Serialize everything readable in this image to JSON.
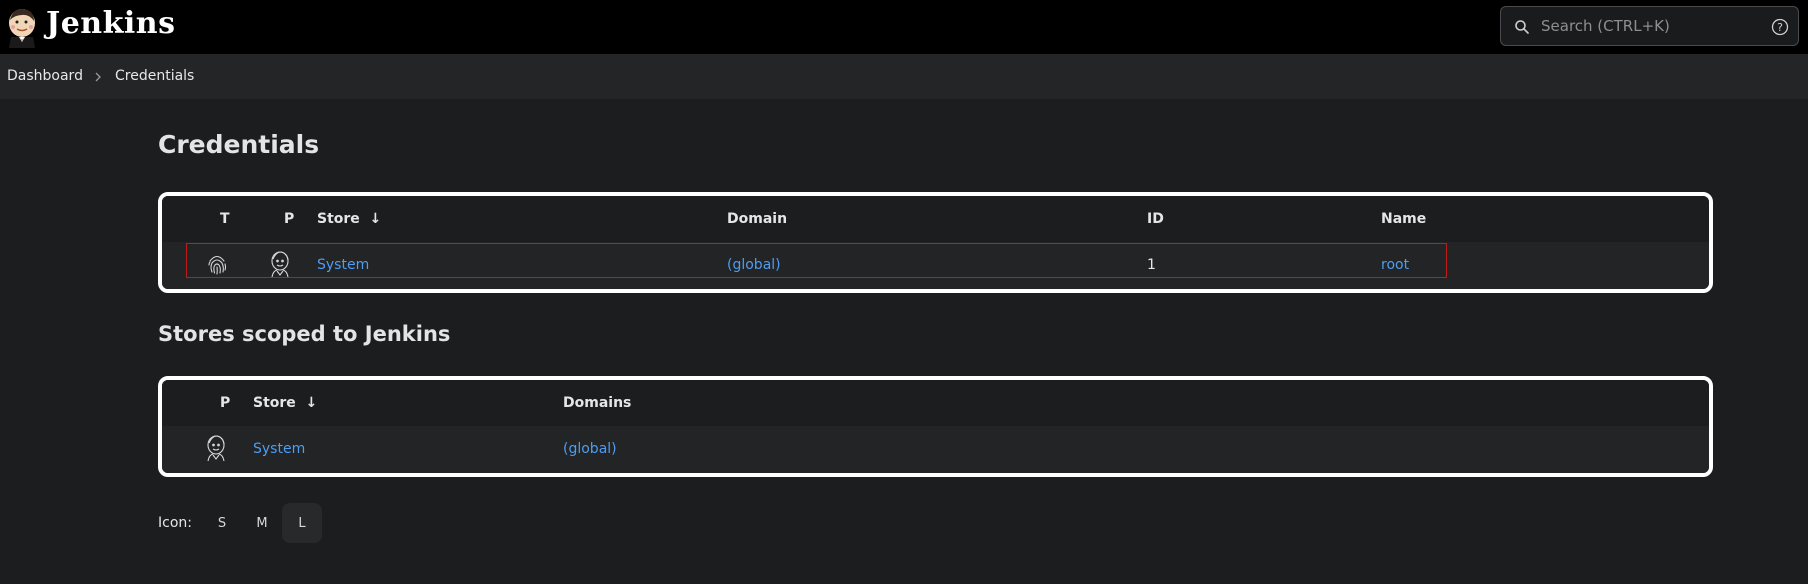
{
  "header": {
    "brand": "Jenkins",
    "search_placeholder": "Search (CTRL+K)",
    "logo_icon": "jenkins-butler-icon",
    "help_icon": "help-circle-icon"
  },
  "breadcrumb": {
    "items": [
      "Dashboard",
      "Credentials"
    ]
  },
  "page_title": "Credentials",
  "credentials_table": {
    "headers": {
      "t": "T",
      "p": "P",
      "store": "Store  ↓",
      "domain": "Domain",
      "id": "ID",
      "name": "Name"
    },
    "rows": [
      {
        "type_icon": "fingerprint-icon",
        "provider_icon": "jenkins-head-icon",
        "store": "System",
        "domain": "(global)",
        "id": "1",
        "name": "root"
      }
    ]
  },
  "stores_title": "Stores scoped to Jenkins",
  "stores_table": {
    "headers": {
      "p": "P",
      "store": "Store  ↓",
      "domains": "Domains"
    },
    "rows": [
      {
        "provider_icon": "jenkins-head-icon",
        "store": "System",
        "domains": "(global)"
      }
    ]
  },
  "icon_size": {
    "label": "Icon:",
    "options": [
      "S",
      "M",
      "L"
    ],
    "selected": "L"
  },
  "colors": {
    "link": "#4f9cf0",
    "highlight": "#c01c1c",
    "header_bg": "#000000"
  }
}
